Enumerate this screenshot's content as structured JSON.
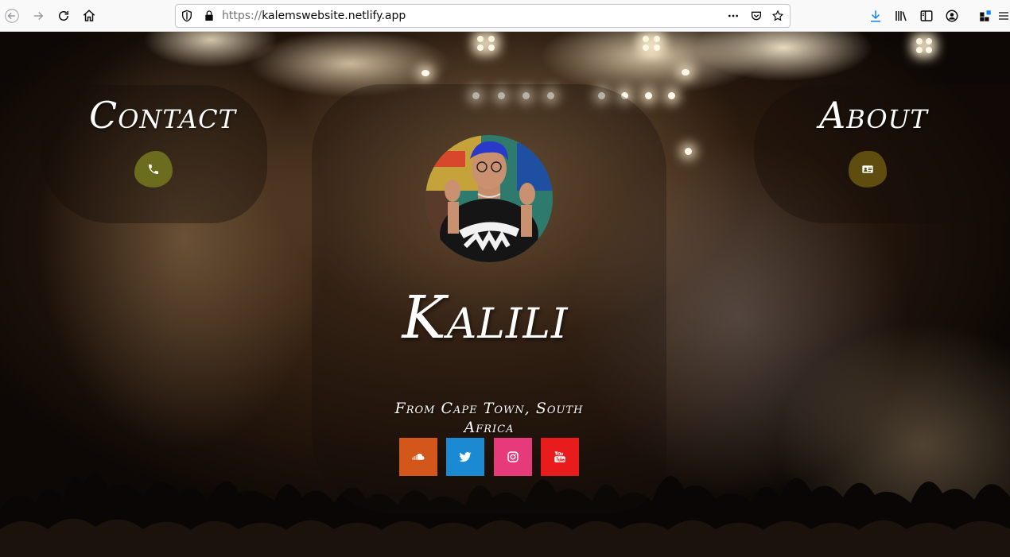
{
  "browser": {
    "url_prefix": "https://",
    "url_host": "kalemswebsite.netlify.app",
    "icons": [
      "back-icon",
      "forward-icon",
      "reload-icon",
      "home-icon",
      "shield-icon",
      "lock-icon",
      "more-icon",
      "pocket-icon",
      "star-icon",
      "download-icon",
      "library-icon",
      "sidebar-icon",
      "account-icon",
      "extensions-icon",
      "menu-icon"
    ]
  },
  "nav": {
    "contact_label": "Contact",
    "about_label": "About",
    "contact_icon": "phone-icon",
    "about_icon": "id-card-icon"
  },
  "profile": {
    "name": "Kalili",
    "location": "From Cape Town, South Africa"
  },
  "social": [
    {
      "name": "soundcloud",
      "color": "#d3561b"
    },
    {
      "name": "twitter",
      "color": "#1b8ad3"
    },
    {
      "name": "instagram",
      "color": "#e63a7a"
    },
    {
      "name": "youtube",
      "color": "#e81c1c"
    }
  ]
}
